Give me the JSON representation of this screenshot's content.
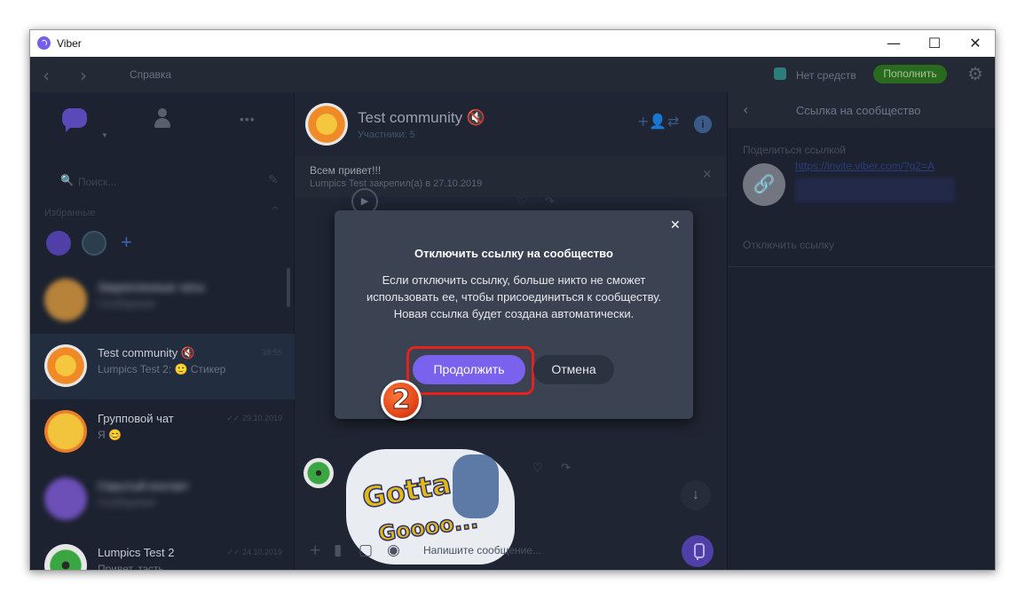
{
  "window": {
    "title": "Viber",
    "minimize": "—",
    "maximize": "☐",
    "close": "✕"
  },
  "topbar": {
    "back": "‹",
    "forward": "›",
    "help": "Справка",
    "credit": "Нет средств",
    "topup": "Пополнить",
    "gear": "⚙"
  },
  "left": {
    "dots": "•••",
    "search_placeholder": "Поиск...",
    "search_icon": "🔍",
    "edit_icon": "✎",
    "favorites_label": "Избранные",
    "favorites_caret": "^",
    "fav_plus": "+",
    "rows": [
      {
        "name": "Закрепленные чаты",
        "msg": "Сообщение",
        "time": ""
      },
      {
        "name": "Test community 🔇",
        "msg": "Lumpics Test 2: 🙂 Стикер",
        "time": "18:55"
      },
      {
        "name": "Групповой чат",
        "msg": "Я 😊",
        "time": "✓✓ 29.10.2019"
      },
      {
        "name": "Скрытый контакт",
        "msg": "Сообщение",
        "time": ""
      },
      {
        "name": "Lumpics Test 2",
        "msg": "Привет, тэсть",
        "time": "✓✓ 24.10.2019"
      }
    ]
  },
  "chat": {
    "title": "Test community 🔇",
    "subtitle": "Участники: 5",
    "add_member_icon": "+👤",
    "share_icon": "⇄",
    "info_icon": "i",
    "pinned_text": "Всем привет!!!",
    "pinned_meta": "Lumpics Test закрепил(а) в 27.10.2019",
    "pinned_close": "✕",
    "play_icon": "▶",
    "heart_icon": "♡",
    "forward_icon": "↷",
    "sticker_text_1": "Gotta",
    "sticker_text_2": "Goooo...",
    "scroll_down": "↓",
    "input_placeholder": "Напишите сообщение...",
    "input_icons": [
      "+",
      "▮",
      "▢",
      "◉"
    ]
  },
  "right": {
    "back": "‹",
    "title": "Ссылка на сообщество",
    "share_label": "Поделиться ссылкой",
    "link_icon": "🔗",
    "url": "https://invite.viber.com/?g2=A",
    "disable_link": "Отключить ссылку"
  },
  "dialog": {
    "close": "✕",
    "title": "Отключить ссылку на сообщество",
    "text": "Если отключить ссылку, больше никто не сможет использовать ее, чтобы присоединиться к сообществу. Новая ссылка будет создана автоматически.",
    "continue": "Продолжить",
    "cancel": "Отмена"
  },
  "annotation": {
    "step": "2"
  }
}
